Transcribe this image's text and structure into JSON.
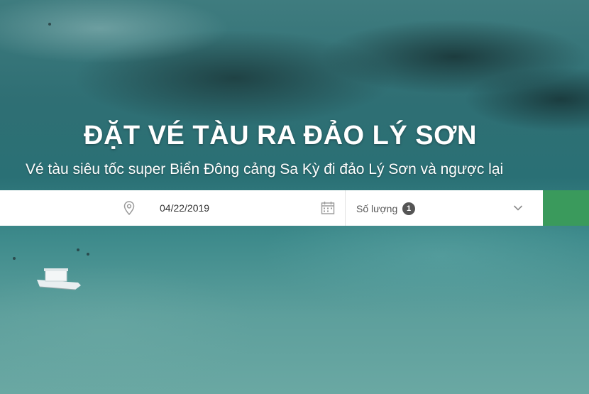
{
  "hero": {
    "title": "ĐẶT VÉ TÀU RA ĐẢO LÝ SƠN",
    "subtitle": "Vé tàu siêu tốc super Biển Đông cảng Sa Kỳ đi đảo Lý Sơn và ngược lại"
  },
  "booking": {
    "location_icon": "map-pin-icon",
    "date_value": "04/22/2019",
    "calendar_icon": "calendar-icon",
    "quantity_label": "Số lượng",
    "quantity_count": "1",
    "dropdown_icon": "chevron-down-icon"
  },
  "colors": {
    "submit_button": "#3a9a5c",
    "badge": "#555555",
    "water": "#2f6f74"
  }
}
